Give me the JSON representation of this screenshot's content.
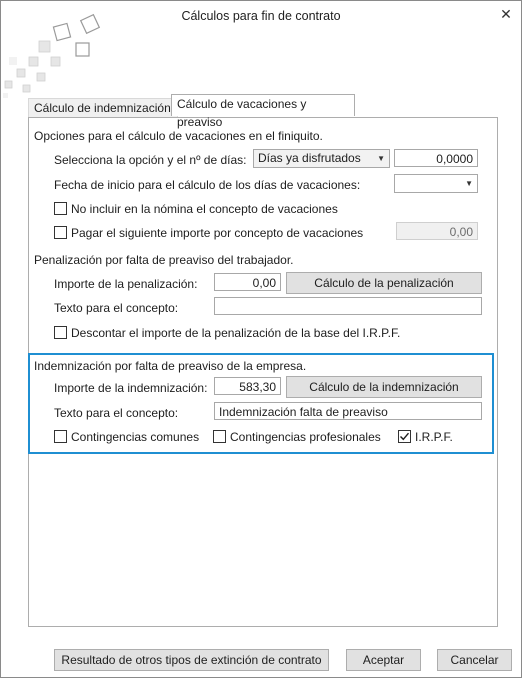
{
  "window": {
    "title": "Cálculos para fin de contrato"
  },
  "tabs": [
    {
      "label": "Cálculo de indemnización",
      "active": false
    },
    {
      "label": "Cálculo de vacaciones y preaviso",
      "active": true
    }
  ],
  "vacaciones": {
    "heading": "Opciones para el cálculo de vacaciones en el finiquito.",
    "dias_label": "Selecciona la opción y el nº de días:",
    "dias_option": "Días ya disfrutados",
    "dias_value": "0,0000",
    "fecha_label": "Fecha de inicio para el cálculo de los días de vacaciones:",
    "fecha_value": "",
    "no_incluir_label": "No incluir en la nómina el concepto de vacaciones",
    "no_incluir_checked": false,
    "pagar_label": "Pagar el siguiente importe por concepto de vacaciones",
    "pagar_checked": false,
    "pagar_value": "0,00"
  },
  "penalizacion": {
    "heading": "Penalización por falta de preaviso del trabajador.",
    "importe_label": "Importe de la penalización:",
    "importe_value": "0,00",
    "calc_button": "Cálculo de la penalización",
    "texto_label": "Texto para el concepto:",
    "texto_value": "",
    "descontar_label": "Descontar el importe de la penalización de la base del I.R.P.F.",
    "descontar_checked": false
  },
  "indemnizacion": {
    "heading": "Indemnización por falta de preaviso de la empresa.",
    "importe_label": "Importe de la indemnización:",
    "importe_value": "583,30",
    "calc_button": "Cálculo de la indemnización",
    "texto_label": "Texto para el concepto:",
    "texto_value": "Indemnización falta de preaviso",
    "cont_comunes_label": "Contingencias comunes",
    "cont_comunes_checked": false,
    "cont_prof_label": "Contingencias profesionales",
    "cont_prof_checked": false,
    "irpf_label": "I.R.P.F.",
    "irpf_checked": true
  },
  "footer": {
    "resultado_button": "Resultado de otros tipos de extinción de contrato",
    "aceptar_button": "Aceptar",
    "cancelar_button": "Cancelar"
  },
  "colors": {
    "accent_border": "#1f8fd2",
    "button_bg": "#e1e1e1"
  },
  "icons": {
    "close": "close-icon",
    "logo": "app-logo-icon",
    "dropdown": "chevron-down-icon",
    "check": "check-icon"
  }
}
